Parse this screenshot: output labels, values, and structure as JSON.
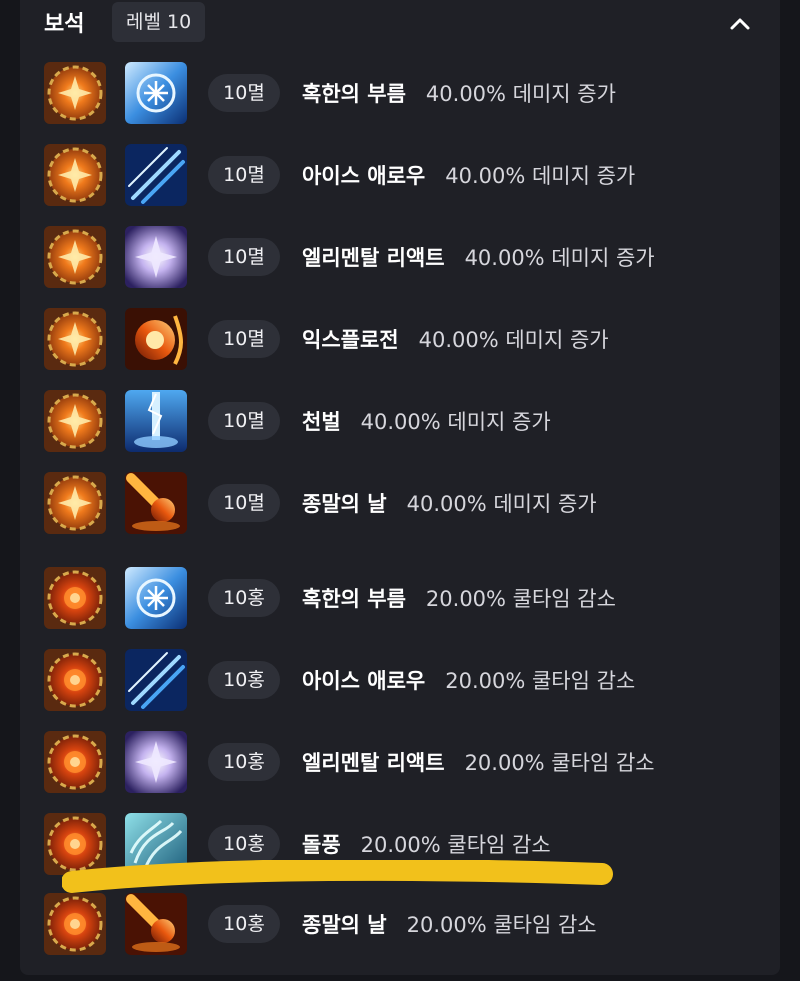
{
  "header": {
    "title": "보석",
    "level_badge": "레벨 10"
  },
  "colors": {
    "panel": "#1f2026",
    "badge": "#2e3038",
    "highlight": "#f2c11b"
  },
  "gems": [
    {
      "tier": "10멸",
      "gem_type": "damage",
      "skill": "혹한의 부름",
      "skill_icon": "snowflake-skill-icon",
      "effect": "40.00% 데미지 증가"
    },
    {
      "tier": "10멸",
      "gem_type": "damage",
      "skill": "아이스 애로우",
      "skill_icon": "ice-arrow-skill-icon",
      "effect": "40.00% 데미지 증가"
    },
    {
      "tier": "10멸",
      "gem_type": "damage",
      "skill": "엘리멘탈 리액트",
      "skill_icon": "crystal-flower-skill-icon",
      "effect": "40.00% 데미지 증가"
    },
    {
      "tier": "10멸",
      "gem_type": "damage",
      "skill": "익스플로전",
      "skill_icon": "fire-burst-skill-icon",
      "effect": "40.00% 데미지 증가"
    },
    {
      "tier": "10멸",
      "gem_type": "damage",
      "skill": "천벌",
      "skill_icon": "lightning-pillar-skill-icon",
      "effect": "40.00% 데미지 증가"
    },
    {
      "tier": "10멸",
      "gem_type": "damage",
      "skill": "종말의 날",
      "skill_icon": "meteor-skill-icon",
      "effect": "40.00% 데미지 증가"
    },
    {
      "tier": "10홍",
      "gem_type": "cooldown",
      "skill": "혹한의 부름",
      "skill_icon": "snowflake-skill-icon",
      "effect": "20.00% 쿨타임 감소"
    },
    {
      "tier": "10홍",
      "gem_type": "cooldown",
      "skill": "아이스 애로우",
      "skill_icon": "ice-arrow-skill-icon",
      "effect": "20.00% 쿨타임 감소"
    },
    {
      "tier": "10홍",
      "gem_type": "cooldown",
      "skill": "엘리멘탈 리액트",
      "skill_icon": "crystal-flower-skill-icon",
      "effect": "20.00% 쿨타임 감소"
    },
    {
      "tier": "10홍",
      "gem_type": "cooldown",
      "skill": "돌풍",
      "skill_icon": "gust-skill-icon",
      "effect": "20.00% 쿨타임 감소"
    },
    {
      "tier": "10홍",
      "gem_type": "cooldown",
      "skill": "종말의 날",
      "skill_icon": "meteor-skill-icon",
      "effect": "20.00% 쿨타임 감소"
    }
  ]
}
